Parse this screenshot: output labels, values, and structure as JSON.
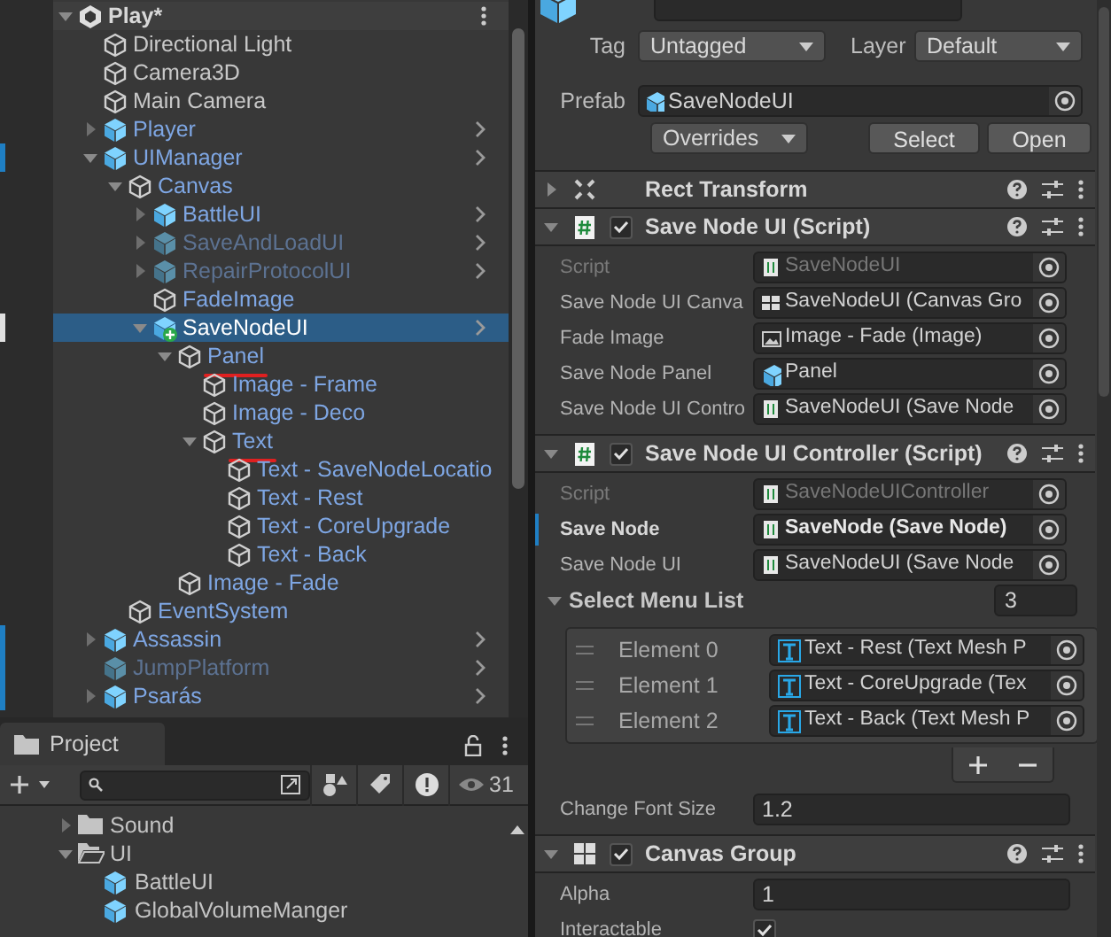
{
  "hierarchy": {
    "items": [
      {
        "name": "Play*",
        "kind": "scene",
        "expanded": true,
        "selected": false,
        "children": [
          {
            "name": "Directional Light",
            "kind": "object",
            "selected": false
          },
          {
            "name": "Camera3D",
            "kind": "object",
            "selected": false
          },
          {
            "name": "Main Camera",
            "kind": "object",
            "selected": false
          },
          {
            "name": "Player",
            "kind": "prefab",
            "expanded": false,
            "selected": false
          },
          {
            "name": "UIManager",
            "kind": "prefab",
            "expanded": true,
            "modified": true,
            "selected": false,
            "children": [
              {
                "name": "Canvas",
                "kind": "child",
                "expanded": true,
                "selected": false,
                "children": [
                  {
                    "name": "BattleUI",
                    "kind": "prefab",
                    "expanded": false,
                    "selected": false
                  },
                  {
                    "name": "SaveAndLoadUI",
                    "kind": "prefab",
                    "expanded": false,
                    "disabled": true,
                    "selected": false
                  },
                  {
                    "name": "RepairProtocolUI",
                    "kind": "prefab",
                    "expanded": false,
                    "disabled": true,
                    "selected": false
                  },
                  {
                    "name": "FadeImage",
                    "kind": "child",
                    "selected": false
                  },
                  {
                    "name": "SaveNodeUI",
                    "kind": "prefab",
                    "expanded": true,
                    "modified": true,
                    "added": true,
                    "selected": true,
                    "children": [
                      {
                        "name": "Panel",
                        "kind": "child",
                        "expanded": true,
                        "marked": true,
                        "selected": false,
                        "children": [
                          {
                            "name": "Image - Frame",
                            "kind": "child",
                            "selected": false
                          },
                          {
                            "name": "Image - Deco",
                            "kind": "child",
                            "selected": false
                          },
                          {
                            "name": "Text",
                            "kind": "child",
                            "expanded": true,
                            "marked": true,
                            "selected": false,
                            "children": [
                              {
                                "name": "Text - SaveNodeLocatio",
                                "kind": "child",
                                "selected": false
                              },
                              {
                                "name": "Text - Rest",
                                "kind": "child",
                                "selected": false
                              },
                              {
                                "name": "Text - CoreUpgrade",
                                "kind": "child",
                                "selected": false
                              },
                              {
                                "name": "Text - Back",
                                "kind": "child",
                                "selected": false
                              }
                            ]
                          }
                        ]
                      },
                      {
                        "name": "Image - Fade",
                        "kind": "child",
                        "selected": false
                      }
                    ]
                  }
                ]
              },
              {
                "name": "EventSystem",
                "kind": "child",
                "selected": false
              }
            ]
          },
          {
            "name": "Assassin",
            "kind": "prefab",
            "expanded": false,
            "modified": true,
            "selected": false
          },
          {
            "name": "JumpPlatform",
            "kind": "prefab",
            "disabled": true,
            "modified": true,
            "selected": false
          },
          {
            "name": "Psarás",
            "kind": "prefab",
            "expanded": false,
            "modified": true,
            "selected": false
          }
        ]
      }
    ]
  },
  "project": {
    "tab": "Project",
    "count": "31",
    "items": [
      {
        "name": "Sound",
        "kind": "folder",
        "expanded": false
      },
      {
        "name": "UI",
        "kind": "folder",
        "expanded": true,
        "children": [
          {
            "name": "BattleUI",
            "kind": "prefab"
          },
          {
            "name": "GlobalVolumeManger",
            "kind": "prefab"
          }
        ]
      }
    ]
  },
  "inspector": {
    "tag_label": "Tag",
    "tag": "Untagged",
    "layer_label": "Layer",
    "layer": "Default",
    "prefab_label": "Prefab",
    "prefab": "SaveNodeUI",
    "overrides": "Overrides",
    "buttons": [
      "Select",
      "Open"
    ],
    "components": [
      {
        "title": "Rect Transform",
        "kind": "transform",
        "expanded": false
      },
      {
        "title": "Save Node UI (Script)",
        "kind": "script",
        "enabled": true,
        "expanded": true,
        "fields": [
          {
            "label": "Script",
            "kind": "script_ref",
            "value": "SaveNodeUI",
            "disabled": true
          },
          {
            "label": "Save Node UI Canva",
            "kind": "canvas_ref",
            "value": "SaveNodeUI (Canvas Gro"
          },
          {
            "label": "Fade Image",
            "kind": "image_ref",
            "value": "Image - Fade (Image)"
          },
          {
            "label": "Save Node Panel",
            "kind": "prefab_ref",
            "value": "Panel"
          },
          {
            "label": "Save Node UI Contro",
            "kind": "script_ref",
            "value": "SaveNodeUI (Save Node"
          }
        ]
      },
      {
        "title": "Save Node UI Controller (Script)",
        "kind": "script",
        "enabled": true,
        "expanded": true,
        "fields": [
          {
            "label": "Script",
            "kind": "script_ref",
            "value": "SaveNodeUIController",
            "disabled": true
          },
          {
            "label": "Save Node",
            "kind": "script_ref",
            "value": "SaveNode (Save Node)",
            "overridden": true
          },
          {
            "label": "Save Node UI",
            "kind": "script_ref",
            "value": "SaveNodeUI (Save Node"
          },
          {
            "label": "Select Menu List",
            "kind": "list",
            "size": "3",
            "expanded": true,
            "elements": [
              {
                "label": "Element 0",
                "kind": "text_ref",
                "value": "Text - Rest (Text Mesh P"
              },
              {
                "label": "Element 1",
                "kind": "text_ref",
                "value": "Text - CoreUpgrade (Tex"
              },
              {
                "label": "Element 2",
                "kind": "text_ref",
                "value": "Text - Back (Text Mesh P"
              }
            ]
          },
          {
            "label": "Change Font Size",
            "kind": "number",
            "value": "1.2"
          }
        ]
      },
      {
        "title": "Canvas Group",
        "kind": "canvas_group",
        "enabled": true,
        "expanded": true,
        "fields": [
          {
            "label": "Alpha",
            "kind": "number",
            "value": "1"
          },
          {
            "label": "Interactable",
            "kind": "checkbox",
            "checked": true
          }
        ]
      }
    ]
  }
}
